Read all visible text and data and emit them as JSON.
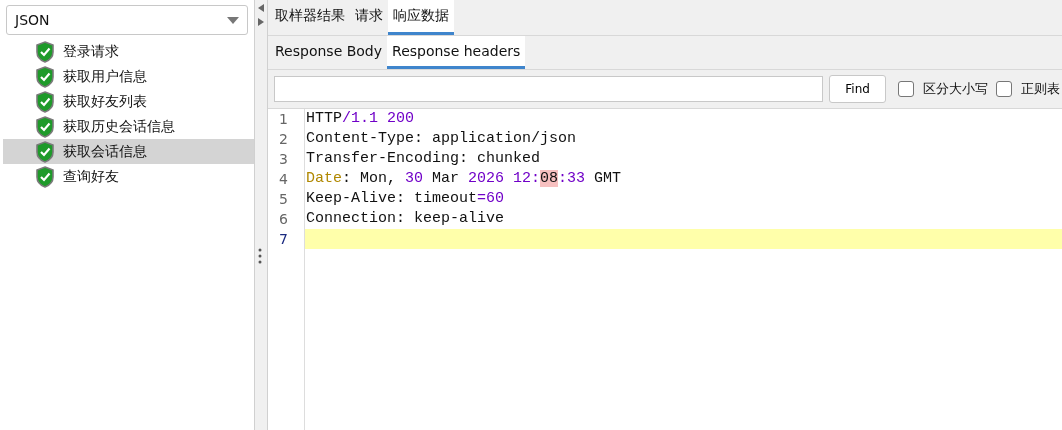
{
  "renderer": {
    "value": "JSON"
  },
  "samples": [
    {
      "label": "登录请求",
      "selected": false
    },
    {
      "label": "获取用户信息",
      "selected": false
    },
    {
      "label": "获取好友列表",
      "selected": false
    },
    {
      "label": "获取历史会话信息",
      "selected": false
    },
    {
      "label": "获取会话信息",
      "selected": true
    },
    {
      "label": "查询好友",
      "selected": false
    }
  ],
  "tabs": [
    {
      "label": "取样器结果",
      "selected": false
    },
    {
      "label": "请求",
      "selected": false
    },
    {
      "label": "响应数据",
      "selected": true
    }
  ],
  "subtabs": [
    {
      "label": "Response Body",
      "selected": false
    },
    {
      "label": "Response headers",
      "selected": true
    }
  ],
  "search": {
    "find_button": "Find",
    "options": [
      {
        "label": "区分大小写",
        "checked": false
      },
      {
        "label": "正则表",
        "checked": false
      }
    ]
  },
  "editor": {
    "lines": [
      {
        "number": "1",
        "current": false,
        "tokens": [
          {
            "text": "HTTP",
            "kind": "plain"
          },
          {
            "text": "/1.1 200",
            "kind": "number"
          }
        ]
      },
      {
        "number": "2",
        "current": false,
        "tokens": [
          {
            "text": "Content-Type: application/json",
            "kind": "plain"
          }
        ]
      },
      {
        "number": "3",
        "current": false,
        "tokens": [
          {
            "text": "Transfer-Encoding: chunked",
            "kind": "plain"
          }
        ]
      },
      {
        "number": "4",
        "current": false,
        "tokens": [
          {
            "text": "Date",
            "kind": "keyword"
          },
          {
            "text": ": Mon, ",
            "kind": "plain"
          },
          {
            "text": "30",
            "kind": "number"
          },
          {
            "text": " Mar ",
            "kind": "plain"
          },
          {
            "text": "2026 12:",
            "kind": "number"
          },
          {
            "text": "08",
            "kind": "match"
          },
          {
            "text": ":33",
            "kind": "number"
          },
          {
            "text": " GMT",
            "kind": "plain"
          }
        ]
      },
      {
        "number": "5",
        "current": false,
        "tokens": [
          {
            "text": "Keep-Alive: timeout",
            "kind": "plain"
          },
          {
            "text": "=60",
            "kind": "number"
          }
        ]
      },
      {
        "number": "6",
        "current": false,
        "tokens": [
          {
            "text": "Connection: keep-alive",
            "kind": "plain"
          }
        ]
      },
      {
        "number": "7",
        "current": true
      }
    ]
  }
}
